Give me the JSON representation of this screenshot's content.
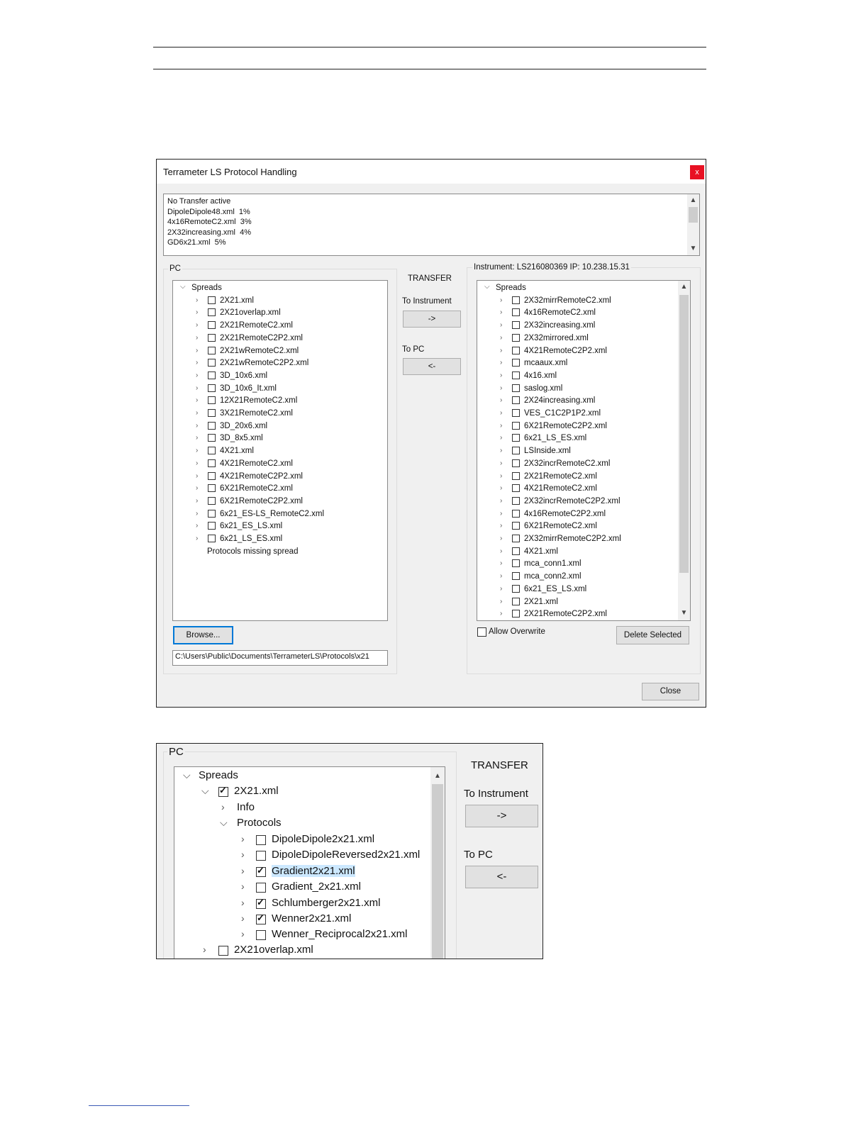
{
  "dialog": {
    "title": "Terrameter LS Protocol Handling",
    "close_x": "x",
    "log_lines": [
      "No Transfer active",
      "DipoleDipole48.xml  1%",
      "4x16RemoteC2.xml  3%",
      "2X32increasing.xml  4%",
      "GD6x21.xml  5%"
    ],
    "pc_group_label": "PC",
    "pc_tree_root": "Spreads",
    "pc_items": [
      "2X21.xml",
      "2X21overlap.xml",
      "2X21RemoteC2.xml",
      "2X21RemoteC2P2.xml",
      "2X21wRemoteC2.xml",
      "2X21wRemoteC2P2.xml",
      "3D_10x6.xml",
      "3D_10x6_It.xml",
      "12X21RemoteC2.xml",
      "3X21RemoteC2.xml",
      "3D_20x6.xml",
      "3D_8x5.xml",
      "4X21.xml",
      "4X21RemoteC2.xml",
      "4X21RemoteC2P2.xml",
      "6X21RemoteC2.xml",
      "6X21RemoteC2P2.xml",
      "6x21_ES-LS_RemoteC2.xml",
      "6x21_ES_LS.xml",
      "6x21_LS_ES.xml"
    ],
    "pc_missing": "Protocols missing spread",
    "browse_label": "Browse...",
    "path_value": "C:\\Users\\Public\\Documents\\TerrameterLS\\Protocols\\x21",
    "transfer_label": "TRANSFER",
    "to_instrument_label": "To Instrument",
    "to_instrument_button": "->",
    "to_pc_label": "To PC",
    "to_pc_button": "<-",
    "instrument_group_label": "Instrument: LS216080369 IP: 10.238.15.31",
    "instrument_tree_root": "Spreads",
    "instrument_items": [
      "2X32mirrRemoteC2.xml",
      "4x16RemoteC2.xml",
      "2X32increasing.xml",
      "2X32mirrored.xml",
      "4X21RemoteC2P2.xml",
      "mcaaux.xml",
      "4x16.xml",
      "saslog.xml",
      "2X24increasing.xml",
      "VES_C1C2P1P2.xml",
      "6X21RemoteC2P2.xml",
      "6x21_LS_ES.xml",
      "LSInside.xml",
      "2X32incrRemoteC2.xml",
      "2X21RemoteC2.xml",
      "4X21RemoteC2.xml",
      "2X32incrRemoteC2P2.xml",
      "4x16RemoteC2P2.xml",
      "6X21RemoteC2.xml",
      "2X32mirrRemoteC2P2.xml",
      "4X21.xml",
      "mca_conn1.xml",
      "mca_conn2.xml",
      "6x21_ES_LS.xml",
      "2X21.xml",
      "2X21RemoteC2P2.xml"
    ],
    "allow_overwrite_label": "Allow Overwrite",
    "delete_selected_label": "Delete Selected",
    "close_label": "Close"
  },
  "zoom": {
    "pc_group_label": "PC",
    "root": "Spreads",
    "spread": "2X21.xml",
    "info": "Info",
    "protocols": "Protocols",
    "protocol_items": [
      {
        "name": "DipoleDipole2x21.xml",
        "checked": false
      },
      {
        "name": "DipoleDipoleReversed2x21.xml",
        "checked": false
      },
      {
        "name": "Gradient2x21.xml",
        "checked": true
      },
      {
        "name": "Gradient_2x21.xml",
        "checked": false
      },
      {
        "name": "Schlumberger2x21.xml",
        "checked": true
      },
      {
        "name": "Wenner2x21.xml",
        "checked": true
      },
      {
        "name": "Wenner_Reciprocal2x21.xml",
        "checked": false
      }
    ],
    "next_spread": "2X21overlap.xml",
    "transfer_label": "TRANSFER",
    "to_instrument_label": "To Instrument",
    "to_instrument_button": "->",
    "to_pc_label": "To PC",
    "to_pc_button": "<-"
  }
}
